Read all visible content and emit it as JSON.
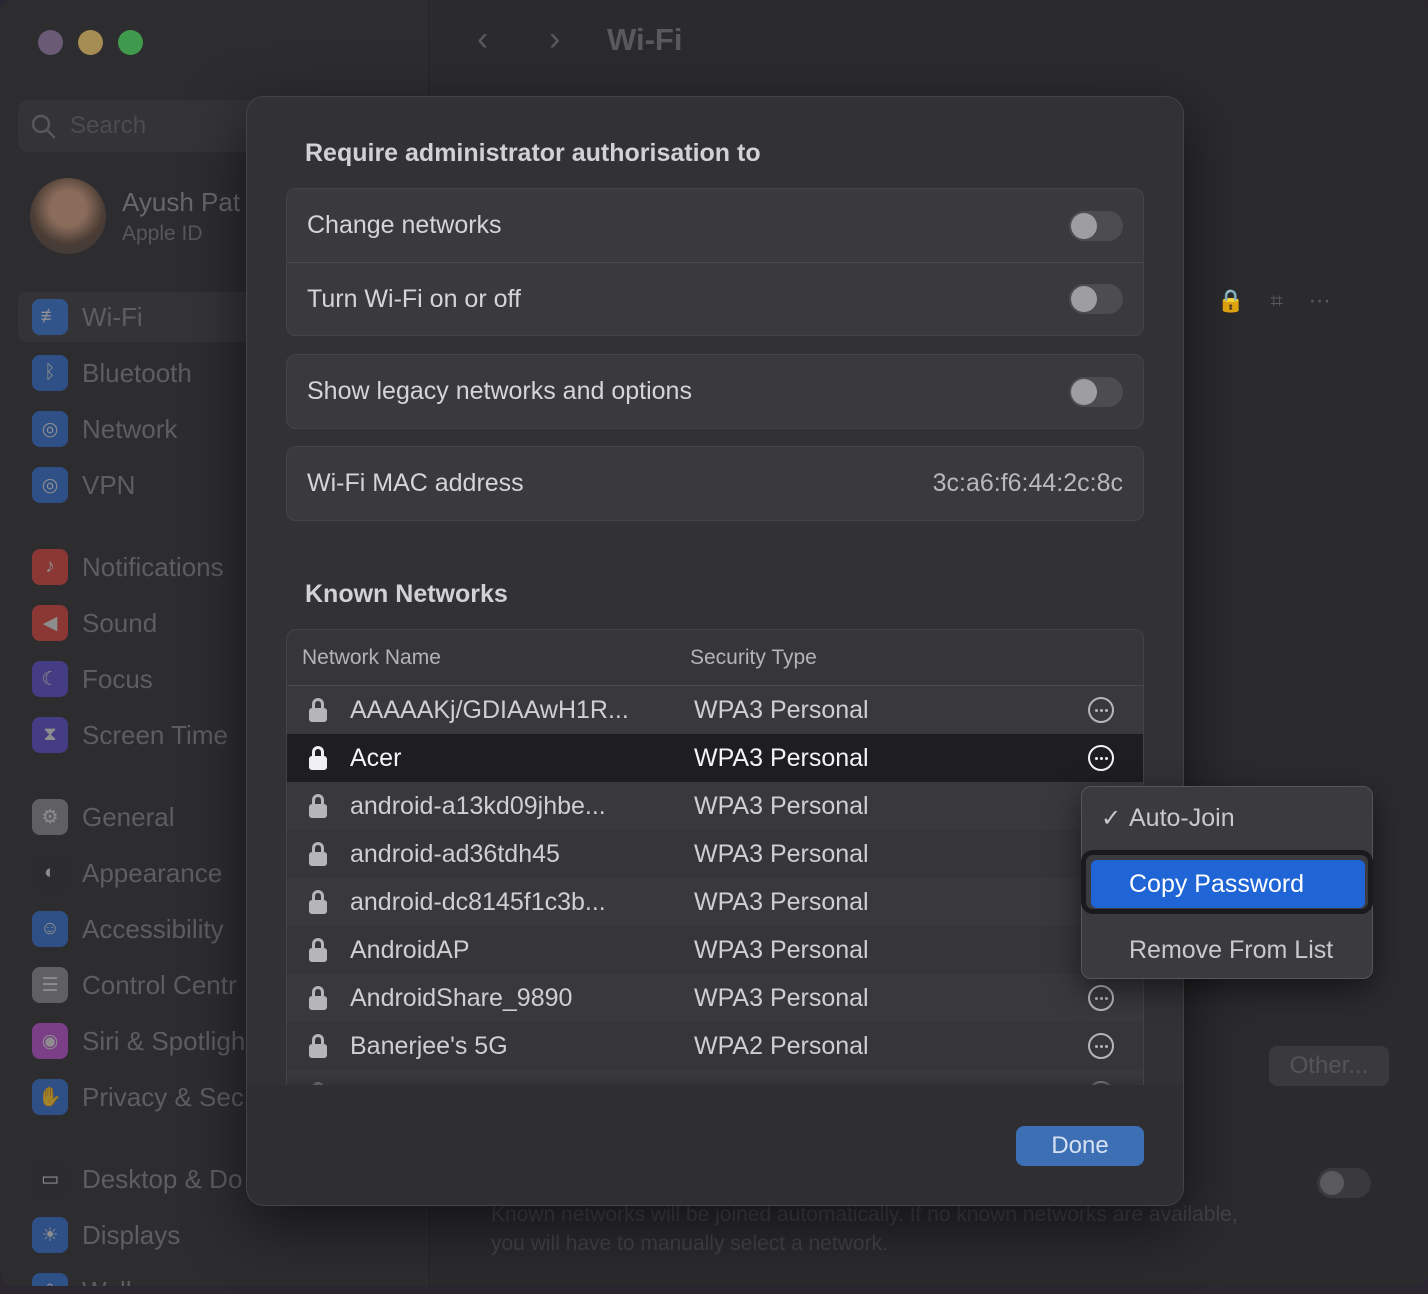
{
  "window": {
    "title": "Wi-Fi",
    "traffic_colors": [
      "#6b5a76",
      "#a48c52",
      "#3f9a4e"
    ]
  },
  "sidebar": {
    "search_placeholder": "Search",
    "user": {
      "name": "Ayush Pat",
      "sub": "Apple ID"
    },
    "items": [
      {
        "label": "Wi-Fi",
        "icon": "wifi-icon",
        "color": "#2f6fd0"
      },
      {
        "label": "Bluetooth",
        "icon": "bluetooth-icon",
        "color": "#2f6fd0"
      },
      {
        "label": "Network",
        "icon": "globe-icon",
        "color": "#2f6fd0"
      },
      {
        "label": "VPN",
        "icon": "globe-icon",
        "color": "#2f6fd0"
      },
      {
        "label": "Notifications",
        "icon": "bell-icon",
        "color": "#d8433a"
      },
      {
        "label": "Sound",
        "icon": "speaker-icon",
        "color": "#d8433a"
      },
      {
        "label": "Focus",
        "icon": "moon-icon",
        "color": "#5a4bc9"
      },
      {
        "label": "Screen Time",
        "icon": "hourglass-icon",
        "color": "#5a4bc9"
      },
      {
        "label": "General",
        "icon": "gear-icon",
        "color": "#8b8a8e"
      },
      {
        "label": "Appearance",
        "icon": "appearance-icon",
        "color": "#2c2c2e"
      },
      {
        "label": "Accessibility",
        "icon": "accessibility-icon",
        "color": "#2f6fd0"
      },
      {
        "label": "Control Centr",
        "icon": "control-centre-icon",
        "color": "#8b8a8e"
      },
      {
        "label": "Siri & Spotligh",
        "icon": "siri-icon",
        "color": "#b94fd0"
      },
      {
        "label": "Privacy & Sec",
        "icon": "hand-icon",
        "color": "#2f6fd0"
      },
      {
        "label": "Desktop & Do",
        "icon": "desktop-icon",
        "color": "#2c2c2e"
      },
      {
        "label": "Displays",
        "icon": "sun-icon",
        "color": "#2f6fd0"
      },
      {
        "label": "Wall",
        "icon": "wallpaper-icon",
        "color": "#2f6fd0"
      }
    ]
  },
  "main_bg": {
    "other_button": "Other...",
    "footnote": "Known networks will be joined automatically. If no known networks are available, you will have to manually select a network."
  },
  "sheet": {
    "auth_heading": "Require administrator authorisation to",
    "toggles": [
      {
        "label": "Change networks",
        "on": false
      },
      {
        "label": "Turn Wi-Fi on or off",
        "on": false
      }
    ],
    "legacy": {
      "label": "Show legacy networks and options",
      "on": false
    },
    "mac": {
      "label": "Wi-Fi MAC address",
      "value": "3c:a6:f6:44:2c:8c"
    },
    "known_heading": "Known Networks",
    "table": {
      "headers": {
        "name": "Network Name",
        "security": "Security Type"
      },
      "rows": [
        {
          "name": "AAAAAKj/GDIAAwH1R...",
          "security": "WPA3 Personal",
          "more": true
        },
        {
          "name": "Acer",
          "security": "WPA3 Personal",
          "more": true,
          "selected": true
        },
        {
          "name": "android-a13kd09jhbe...",
          "security": "WPA3 Personal",
          "more": false
        },
        {
          "name": "android-ad36tdh45",
          "security": "WPA3 Personal",
          "more": false
        },
        {
          "name": "android-dc8145f1c3b...",
          "security": "WPA3 Personal",
          "more": false
        },
        {
          "name": "AndroidAP",
          "security": "WPA3 Personal",
          "more": false
        },
        {
          "name": "AndroidShare_9890",
          "security": "WPA3 Personal",
          "more": true
        },
        {
          "name": "Banerjee's 5G",
          "security": "WPA2 Personal",
          "more": true
        },
        {
          "name": "",
          "security": "",
          "more": true
        }
      ]
    },
    "done_button": "Done"
  },
  "context_menu": {
    "items": [
      {
        "label": "Auto-Join",
        "checked": true
      },
      {
        "label": "Copy Password",
        "highlighted": true
      },
      {
        "label": "Remove From List"
      }
    ],
    "highlight_color": "#1f65d6"
  }
}
